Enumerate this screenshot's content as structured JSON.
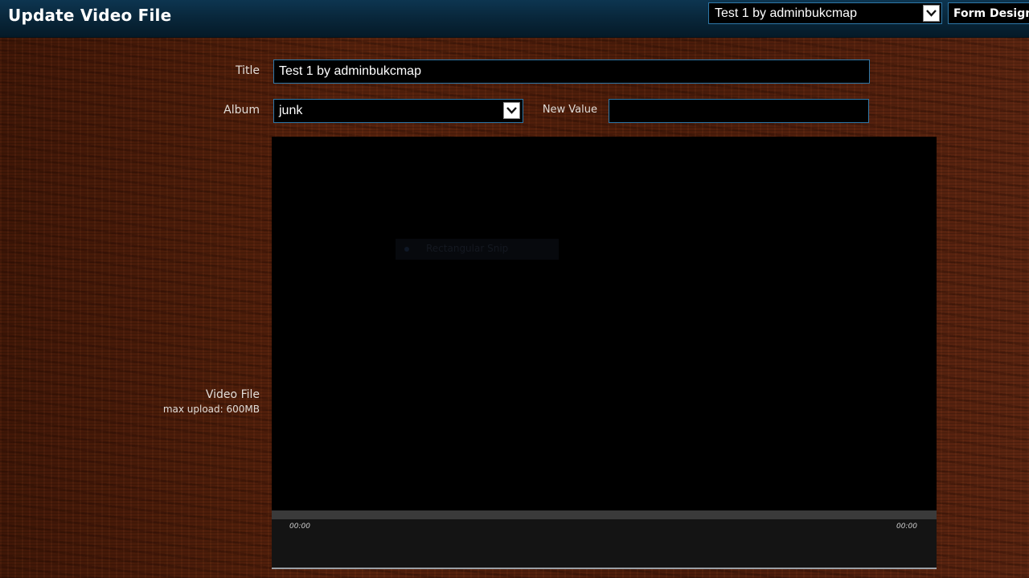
{
  "header": {
    "title": "Update Video File",
    "record_select_value": "Test 1 by adminbukcmap",
    "form_designer_label": "Form Designer"
  },
  "form": {
    "title_label": "Title",
    "title_value": "Test 1 by adminbukcmap",
    "album_label": "Album",
    "album_value": "junk",
    "new_value_label": "New Value",
    "new_value_value": "",
    "video_file_label": "Video File",
    "max_upload_text": "max upload: 600MB"
  },
  "player": {
    "overlay_text": "Rectangular Snip",
    "current_time": "00:00",
    "duration": "00:00"
  },
  "icons": {
    "dropdown": "chevron-down-icon",
    "overlay_bullet": "radio-dot-icon"
  },
  "colors": {
    "header_bg": "#082538",
    "input_border": "#2e78a8",
    "background": "#4a1c0b"
  }
}
